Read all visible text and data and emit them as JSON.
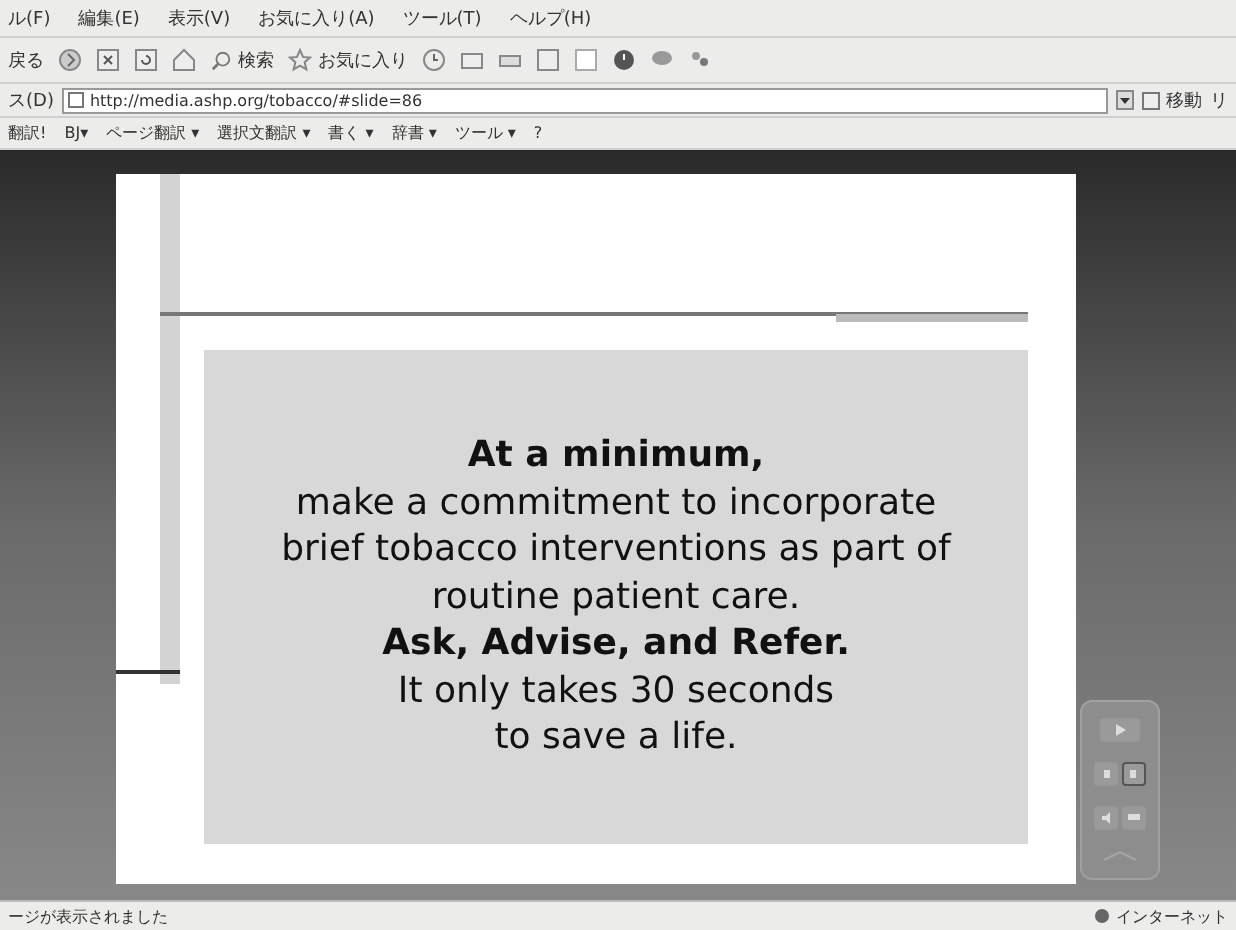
{
  "menu_bar": [
    "ル(F)",
    "編集(E)",
    "表示(V)",
    "お気に入り(A)",
    "ツール(T)",
    "ヘルプ(H)"
  ],
  "toolbar": {
    "back": "戻る",
    "search": "検索",
    "favorites": "お気に入り"
  },
  "address_bar": {
    "label": "ス(D)",
    "url": "http://media.ashp.org/tobacco/#slide=86",
    "go": "移動",
    "links": "リ"
  },
  "links_bar": [
    "翻訳!",
    "BJ▾",
    "ページ翻訳 ▾",
    "選択文翻訳 ▾",
    "書く ▾",
    "辞書 ▾",
    "ツール ▾",
    "?"
  ],
  "slide": {
    "lines": [
      {
        "text": "At a minimum,",
        "kind": "bold"
      },
      {
        "text": "make a commitment to incorporate",
        "kind": "normal"
      },
      {
        "text": "brief tobacco interventions as part of",
        "kind": "normal"
      },
      {
        "text": "routine patient care.",
        "kind": "normal"
      },
      {
        "text": "Ask, Advise, and Refer.",
        "kind": "bold"
      },
      {
        "text": "It only takes 30 seconds",
        "kind": "normal"
      },
      {
        "text": "to save a life.",
        "kind": "normal"
      }
    ]
  },
  "status_bar": {
    "message": "ージが表示されました",
    "zone": "インターネット"
  }
}
